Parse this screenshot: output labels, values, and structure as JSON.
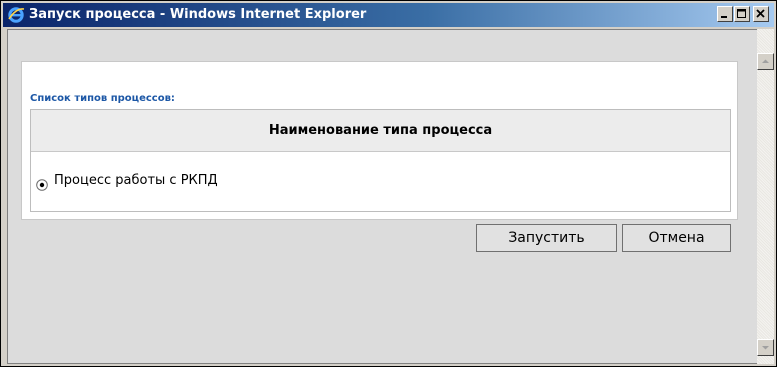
{
  "window": {
    "title": "Запуск процесса - Windows Internet Explorer",
    "controls": {
      "minimize": "minimize",
      "maximize": "maximize",
      "close": "close"
    }
  },
  "dialog": {
    "list_caption": "Список типов процессов:",
    "table": {
      "column_header": "Наименование типа процесса",
      "rows": [
        {
          "label": "Процесс работы с РКПД",
          "selected": true
        }
      ]
    },
    "buttons": {
      "run": "Запустить",
      "cancel": "Отмена"
    }
  },
  "colors": {
    "title_gradient_start": "#0a246a",
    "title_gradient_end": "#a6caf0",
    "caption_blue": "#1c57a6"
  }
}
